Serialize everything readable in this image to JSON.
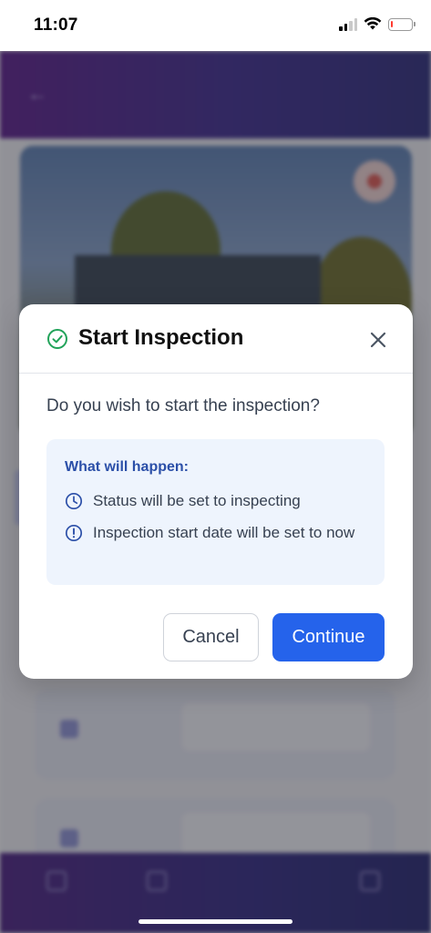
{
  "status_bar": {
    "time": "11:07",
    "battery_level": 0.12,
    "battery_color": "#ff3b30",
    "icons": [
      "signal-icon",
      "wifi-icon",
      "battery-icon"
    ]
  },
  "modal": {
    "title": "Start Inspection",
    "title_icon": "check-circle-icon",
    "close_icon": "close-icon",
    "question": "Do you wish to start the inspection?",
    "info": {
      "heading": "What will happen:",
      "items": [
        {
          "icon": "clock-icon",
          "text": "Status will be set to inspecting"
        },
        {
          "icon": "alert-circle-icon",
          "text": "Inspection start date will be set to now"
        }
      ]
    },
    "buttons": {
      "cancel": "Cancel",
      "continue": "Continue"
    }
  },
  "colors": {
    "success": "#22a35a",
    "primary": "#2563eb",
    "info_heading": "#2b4fa8",
    "info_bg": "#eef4fd",
    "header_gradient_start": "#5a1a8a",
    "header_gradient_end": "#2a2a7a"
  }
}
